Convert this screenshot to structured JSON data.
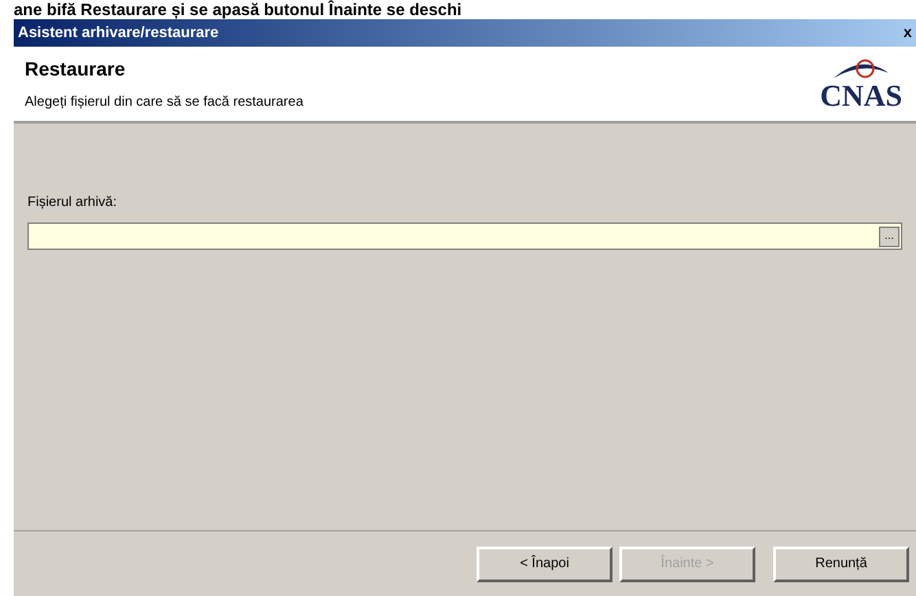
{
  "document_text": "ane bifă Restaurare și se apasă butonul Înainte se deschi",
  "window": {
    "title": "Asistent arhivare/restaurare",
    "close": "x"
  },
  "header": {
    "title": "Restaurare",
    "subtitle": "Alegeți fișierul din care să se facă restaurarea",
    "logo": "CNAS"
  },
  "field": {
    "label": "Fișierul arhivă:",
    "browse": "..."
  },
  "buttons": [
    {
      "label": "< Înapoi",
      "disabled": false
    },
    {
      "label": "Înainte >",
      "disabled": true
    },
    {
      "label": "Renunță",
      "disabled": false
    }
  ]
}
